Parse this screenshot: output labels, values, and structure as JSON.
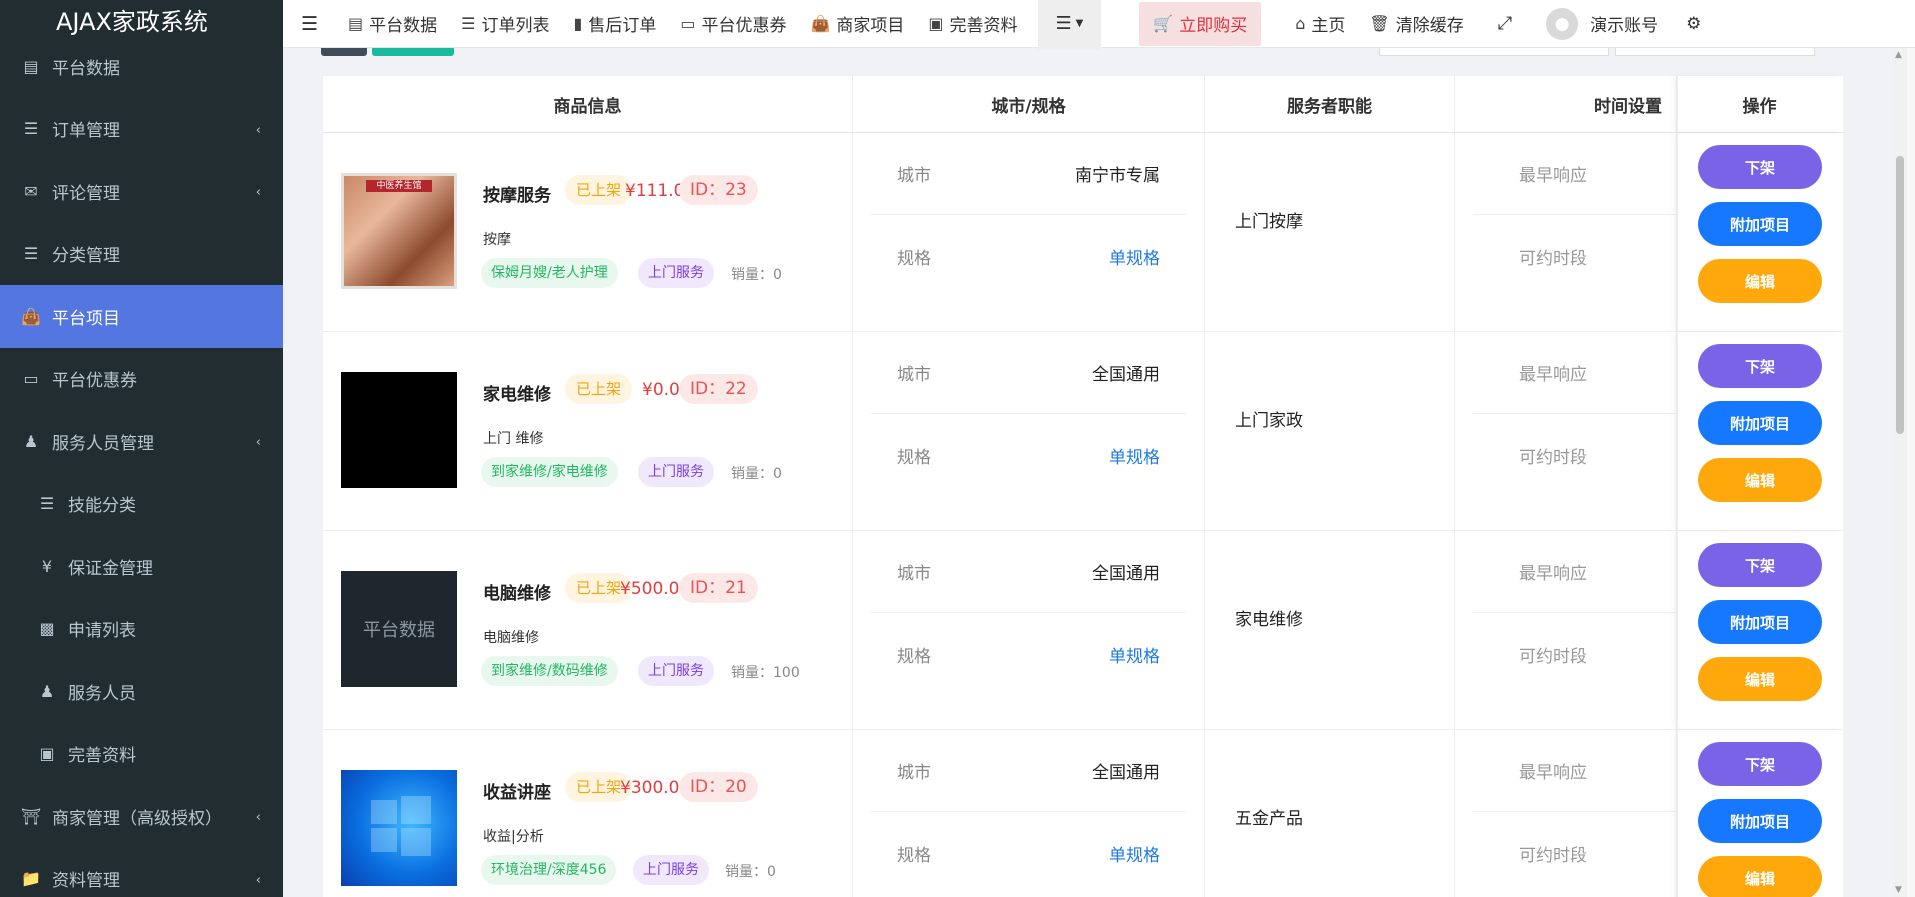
{
  "app": {
    "brand": "AJAX家政系统"
  },
  "sidebar": {
    "items": [
      {
        "label": "平台数据",
        "icon": "bar-chart-icon",
        "chevron": false,
        "sub": false,
        "active": false
      },
      {
        "label": "订单管理",
        "icon": "list-icon",
        "chevron": true,
        "sub": false,
        "active": false
      },
      {
        "label": "评论管理",
        "icon": "comments-icon",
        "chevron": true,
        "sub": false,
        "active": false
      },
      {
        "label": "分类管理",
        "icon": "sliders-icon",
        "chevron": false,
        "sub": false,
        "active": false
      },
      {
        "label": "平台项目",
        "icon": "shopping-bag-icon",
        "chevron": false,
        "sub": false,
        "active": true
      },
      {
        "label": "平台优惠券",
        "icon": "credit-card-icon",
        "chevron": false,
        "sub": false,
        "active": false
      },
      {
        "label": "服务人员管理",
        "icon": "users-icon",
        "chevron": true,
        "sub": false,
        "active": false
      },
      {
        "label": "技能分类",
        "icon": "bars-icon",
        "chevron": false,
        "sub": true,
        "active": false
      },
      {
        "label": "保证金管理",
        "icon": "yen-icon",
        "chevron": false,
        "sub": true,
        "active": false
      },
      {
        "label": "申请列表",
        "icon": "id-card-icon",
        "chevron": false,
        "sub": true,
        "active": false
      },
      {
        "label": "服务人员",
        "icon": "user-icon",
        "chevron": false,
        "sub": true,
        "active": false
      },
      {
        "label": "完善资料",
        "icon": "image-icon",
        "chevron": false,
        "sub": true,
        "active": false
      },
      {
        "label": "商家管理（高级授权）",
        "icon": "bank-icon",
        "chevron": true,
        "sub": false,
        "active": false
      },
      {
        "label": "资料管理",
        "icon": "folder-icon",
        "chevron": true,
        "sub": false,
        "active": false
      }
    ]
  },
  "topnav": {
    "items": [
      {
        "label": "平台数据",
        "icon": "bar-chart-icon"
      },
      {
        "label": "订单列表",
        "icon": "list-icon"
      },
      {
        "label": "售后订单",
        "icon": "columns-icon"
      },
      {
        "label": "平台优惠券",
        "icon": "credit-card-icon"
      },
      {
        "label": "商家项目",
        "icon": "shopping-bag-icon"
      },
      {
        "label": "完善资料",
        "icon": "image-icon"
      }
    ],
    "buy": "立即购买",
    "home": "主页",
    "clear_cache": "清除缓存",
    "account": "演示账号"
  },
  "table": {
    "headers": {
      "goods": "商品信息",
      "city": "城市/规格",
      "role": "服务者职能",
      "time": "时间设置",
      "op": "操作"
    },
    "labels": {
      "city": "城市",
      "spec": "规格",
      "earliest": "最早响应",
      "slot": "可约时段",
      "op_unlist": "下架",
      "op_addon": "附加项目",
      "op_edit": "编辑"
    },
    "rows": [
      {
        "title": "按摩服务",
        "status": "已上架",
        "price": "¥111.00",
        "id": "ID：23",
        "subtitle": "按摩",
        "category": "保姆月嫂/老人护理",
        "service": "上门服务",
        "sales": "销量：0",
        "city": "南宁市专属",
        "spec": "单规格",
        "role": "上门按摩",
        "thumb": "massage",
        "thumb_label": "中医养生馆"
      },
      {
        "title": "家电维修",
        "status": "已上架",
        "price": "¥0.00",
        "id": "ID：22",
        "subtitle": "上门 维修",
        "category": "到家维修/家电维修",
        "service": "上门服务",
        "sales": "销量：0",
        "city": "全国通用",
        "spec": "单规格",
        "role": "上门家政",
        "thumb": "black",
        "thumb_label": ""
      },
      {
        "title": "电脑维修",
        "status": "已上架",
        "price": "¥500.00",
        "id": "ID：21",
        "subtitle": "电脑维修",
        "category": "到家维修/数码维修",
        "service": "上门服务",
        "sales": "销量：100",
        "city": "全国通用",
        "spec": "单规格",
        "role": "家电维修",
        "thumb": "dark",
        "thumb_label": "平台数据"
      },
      {
        "title": "收益讲座",
        "status": "已上架",
        "price": "¥300.00",
        "id": "ID：20",
        "subtitle": "收益|分析",
        "category": "环境治理/深度456",
        "service": "上门服务",
        "sales": "销量：0",
        "city": "全国通用",
        "spec": "单规格",
        "role": "五金产品",
        "thumb": "win",
        "thumb_label": ""
      }
    ]
  }
}
